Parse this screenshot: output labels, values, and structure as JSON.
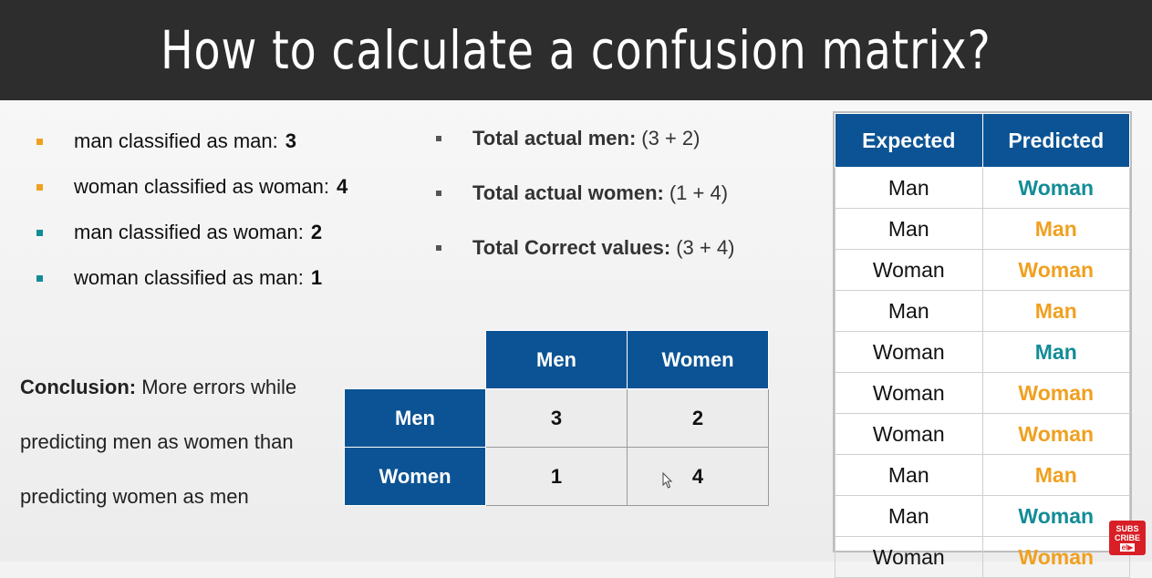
{
  "title": "How to calculate a confusion matrix?",
  "colors": {
    "orange": "#f0a020",
    "teal": "#138c96",
    "navy": "#0b5394"
  },
  "bullets_left": [
    {
      "text": "man classified as man:",
      "value": "3",
      "color": "#f0a020"
    },
    {
      "text": "woman classified as woman:",
      "value": "4",
      "color": "#f0a020"
    },
    {
      "text": "man classified as woman:",
      "value": "2",
      "color": "#138c96"
    },
    {
      "text": "woman classified as man:",
      "value": "1",
      "color": "#138c96"
    }
  ],
  "bullets_mid": [
    {
      "label": "Total actual men:",
      "value": "(3 + 2)"
    },
    {
      "label": "Total actual women:",
      "value": "(1 + 4)"
    },
    {
      "label": "Total Correct values:",
      "value": "(3 + 4)"
    }
  ],
  "conclusion": {
    "label": "Conclusion:",
    "text": "More errors while predicting men as women than predicting women as men"
  },
  "matrix": {
    "col_headers": [
      "Men",
      "Women"
    ],
    "rows": [
      {
        "header": "Men",
        "cells": [
          "3",
          "2"
        ]
      },
      {
        "header": "Women",
        "cells": [
          "1",
          "4"
        ]
      }
    ]
  },
  "table": {
    "headers": [
      "Expected",
      "Predicted"
    ],
    "rows": [
      {
        "expected": "Man",
        "predicted": "Woman",
        "color": "#138c96"
      },
      {
        "expected": "Man",
        "predicted": "Man",
        "color": "#f0a020"
      },
      {
        "expected": "Woman",
        "predicted": "Woman",
        "color": "#f0a020"
      },
      {
        "expected": "Man",
        "predicted": "Man",
        "color": "#f0a020"
      },
      {
        "expected": "Woman",
        "predicted": "Man",
        "color": "#138c96"
      },
      {
        "expected": "Woman",
        "predicted": "Woman",
        "color": "#f0a020"
      },
      {
        "expected": "Woman",
        "predicted": "Woman",
        "color": "#f0a020"
      },
      {
        "expected": "Man",
        "predicted": "Man",
        "color": "#f0a020"
      },
      {
        "expected": "Man",
        "predicted": "Woman",
        "color": "#138c96"
      },
      {
        "expected": "Woman",
        "predicted": "Woman",
        "color": "#f0a020"
      }
    ]
  },
  "subscribe_badge": {
    "line1": "SUBS",
    "line2": "CRIBE",
    "line3": "el▶"
  }
}
